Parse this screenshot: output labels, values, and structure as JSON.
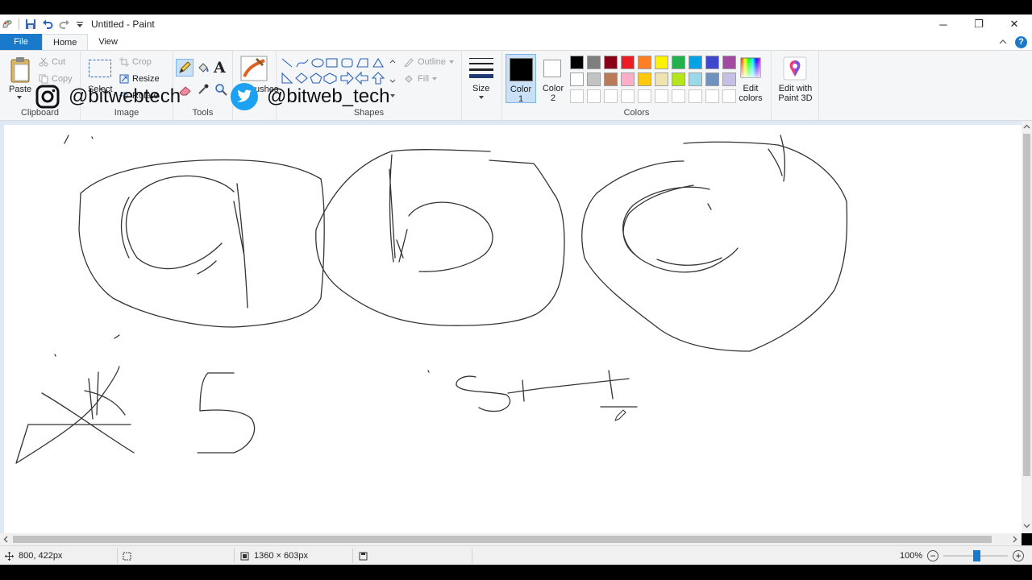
{
  "window": {
    "title": "Untitled - Paint",
    "minimize": "─",
    "restore": "❐",
    "close": "✕"
  },
  "tabs": [
    {
      "label": "File"
    },
    {
      "label": "Home"
    },
    {
      "label": "View"
    }
  ],
  "ribbon": {
    "clipboard": {
      "label": "Clipboard",
      "paste": "Paste",
      "cut": "Cut",
      "copy": "Copy"
    },
    "image": {
      "label": "Image",
      "select": "Select",
      "crop": "Crop",
      "resize": "Resize",
      "rotate": "Rotate"
    },
    "tools": {
      "label": "Tools",
      "text_glyph": "A"
    },
    "brushes": {
      "label": "Brushes"
    },
    "shapes": {
      "label": "Shapes",
      "outline": "Outline",
      "fill": "Fill"
    },
    "size": {
      "label": "Size"
    },
    "colors": {
      "label": "Colors",
      "color1_label": "Color\n1",
      "color2_label": "Color\n2",
      "color1_value": "#000000",
      "color2_value": "#ffffff",
      "edit_colors": "Edit\ncolors",
      "paint3d": "Edit with\nPaint 3D",
      "palette_row1": [
        "#000000",
        "#7f7f7f",
        "#880015",
        "#ed1c24",
        "#ff7f27",
        "#fff200",
        "#22b14c",
        "#00a2e8",
        "#3f48cc",
        "#a349a4"
      ],
      "palette_row2": [
        "#ffffff",
        "#c3c3c3",
        "#b97a57",
        "#ffaec9",
        "#ffc90e",
        "#efe4b0",
        "#b5e61d",
        "#99d9ea",
        "#7092be",
        "#c8bfe7"
      ],
      "palette_row3": [
        "#ffffff",
        "#ffffff",
        "#ffffff",
        "#ffffff",
        "#ffffff",
        "#ffffff",
        "#ffffff",
        "#ffffff",
        "#ffffff",
        "#ffffff"
      ]
    }
  },
  "watermark": {
    "instagram": "@bitwebtech",
    "twitter": "@bitweb_tech"
  },
  "status": {
    "cursor_pos": "800, 422px",
    "canvas_size": "1360 × 603px",
    "zoom": "100%",
    "zoom_out": "−",
    "zoom_in": "+",
    "zoom_level": 0.52
  }
}
